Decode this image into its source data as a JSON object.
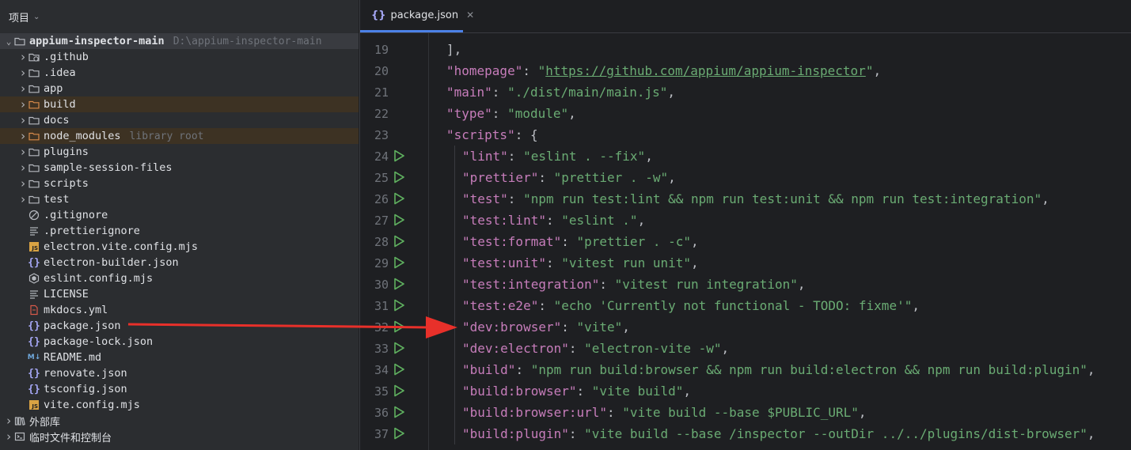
{
  "project_panel": {
    "title": "项目",
    "root": {
      "name": "appium-inspector-main",
      "path": "D:\\appium-inspector-main"
    },
    "items": [
      {
        "name": ".github",
        "icon": "folder-github-icon",
        "kind": "folder"
      },
      {
        "name": ".idea",
        "icon": "folder-icon",
        "kind": "folder"
      },
      {
        "name": "app",
        "icon": "folder-icon",
        "kind": "folder"
      },
      {
        "name": "build",
        "icon": "folder-excluded-icon",
        "kind": "folder",
        "excluded": true
      },
      {
        "name": "docs",
        "icon": "folder-icon",
        "kind": "folder"
      },
      {
        "name": "node_modules",
        "hint": "library root",
        "icon": "folder-excluded-icon",
        "kind": "folder",
        "excluded": true
      },
      {
        "name": "plugins",
        "icon": "folder-icon",
        "kind": "folder"
      },
      {
        "name": "sample-session-files",
        "icon": "folder-icon",
        "kind": "folder"
      },
      {
        "name": "scripts",
        "icon": "folder-icon",
        "kind": "folder"
      },
      {
        "name": "test",
        "icon": "folder-icon",
        "kind": "folder"
      },
      {
        "name": ".gitignore",
        "icon": "ignore-icon",
        "kind": "file"
      },
      {
        "name": ".prettierignore",
        "icon": "text-lines-icon",
        "kind": "file"
      },
      {
        "name": "electron.vite.config.mjs",
        "icon": "js-file-icon",
        "kind": "file"
      },
      {
        "name": "electron-builder.json",
        "icon": "json-file-icon",
        "kind": "file"
      },
      {
        "name": "eslint.config.mjs",
        "icon": "eslint-icon",
        "kind": "file"
      },
      {
        "name": "LICENSE",
        "icon": "text-lines-icon",
        "kind": "file"
      },
      {
        "name": "mkdocs.yml",
        "icon": "yaml-file-icon",
        "kind": "file"
      },
      {
        "name": "package.json",
        "icon": "json-file-icon",
        "kind": "file"
      },
      {
        "name": "package-lock.json",
        "icon": "json-file-icon",
        "kind": "file"
      },
      {
        "name": "README.md",
        "icon": "markdown-file-icon",
        "kind": "file"
      },
      {
        "name": "renovate.json",
        "icon": "json-file-icon",
        "kind": "file"
      },
      {
        "name": "tsconfig.json",
        "icon": "json-file-icon",
        "kind": "file"
      },
      {
        "name": "vite.config.mjs",
        "icon": "js-file-icon",
        "kind": "file"
      }
    ],
    "bottom_items": [
      {
        "name": "外部库",
        "icon": "library-icon"
      },
      {
        "name": "临时文件和控制台",
        "icon": "console-icon"
      }
    ],
    "badge_js": "JS",
    "badge_md": "M↓"
  },
  "editor": {
    "tab": {
      "label": "package.json",
      "icon": "json-file-icon"
    },
    "lines": [
      {
        "n": "19",
        "run": false,
        "indent": 1,
        "tokens": [
          [
            "p",
            "],"
          ]
        ]
      },
      {
        "n": "20",
        "run": false,
        "indent": 1,
        "tokens": [
          [
            "k",
            "\"homepage\""
          ],
          [
            "p",
            ": "
          ],
          [
            "s",
            "\""
          ],
          [
            "u",
            "https://github.com/appium/appium-inspector"
          ],
          [
            "s",
            "\""
          ],
          [
            "p",
            ","
          ]
        ]
      },
      {
        "n": "21",
        "run": false,
        "indent": 1,
        "tokens": [
          [
            "k",
            "\"main\""
          ],
          [
            "p",
            ": "
          ],
          [
            "s",
            "\"./dist/main/main.js\""
          ],
          [
            "p",
            ","
          ]
        ]
      },
      {
        "n": "22",
        "run": false,
        "indent": 1,
        "tokens": [
          [
            "k",
            "\"type\""
          ],
          [
            "p",
            ": "
          ],
          [
            "s",
            "\"module\""
          ],
          [
            "p",
            ","
          ]
        ]
      },
      {
        "n": "23",
        "run": false,
        "indent": 1,
        "tokens": [
          [
            "k",
            "\"scripts\""
          ],
          [
            "p",
            ": {"
          ]
        ]
      },
      {
        "n": "24",
        "run": true,
        "indent": 2,
        "tokens": [
          [
            "k",
            "\"lint\""
          ],
          [
            "p",
            ": "
          ],
          [
            "s",
            "\"eslint . --fix\""
          ],
          [
            "p",
            ","
          ]
        ]
      },
      {
        "n": "25",
        "run": true,
        "indent": 2,
        "tokens": [
          [
            "k",
            "\"prettier\""
          ],
          [
            "p",
            ": "
          ],
          [
            "s",
            "\"prettier . -w\""
          ],
          [
            "p",
            ","
          ]
        ]
      },
      {
        "n": "26",
        "run": true,
        "indent": 2,
        "tokens": [
          [
            "k",
            "\"test\""
          ],
          [
            "p",
            ": "
          ],
          [
            "s",
            "\"npm run test:lint && npm run test:unit && npm run test:integration\""
          ],
          [
            "p",
            ","
          ]
        ]
      },
      {
        "n": "27",
        "run": true,
        "indent": 2,
        "tokens": [
          [
            "k",
            "\"test:lint\""
          ],
          [
            "p",
            ": "
          ],
          [
            "s",
            "\"eslint .\""
          ],
          [
            "p",
            ","
          ]
        ]
      },
      {
        "n": "28",
        "run": true,
        "indent": 2,
        "tokens": [
          [
            "k",
            "\"test:format\""
          ],
          [
            "p",
            ": "
          ],
          [
            "s",
            "\"prettier . -c\""
          ],
          [
            "p",
            ","
          ]
        ]
      },
      {
        "n": "29",
        "run": true,
        "indent": 2,
        "tokens": [
          [
            "k",
            "\"test:unit\""
          ],
          [
            "p",
            ": "
          ],
          [
            "s",
            "\"vitest run unit\""
          ],
          [
            "p",
            ","
          ]
        ]
      },
      {
        "n": "30",
        "run": true,
        "indent": 2,
        "tokens": [
          [
            "k",
            "\"test:integration\""
          ],
          [
            "p",
            ": "
          ],
          [
            "s",
            "\"vitest run integration\""
          ],
          [
            "p",
            ","
          ]
        ]
      },
      {
        "n": "31",
        "run": true,
        "indent": 2,
        "tokens": [
          [
            "k",
            "\"test:e2e\""
          ],
          [
            "p",
            ": "
          ],
          [
            "s",
            "\"echo 'Currently not functional - TODO: fixme'\""
          ],
          [
            "p",
            ","
          ]
        ]
      },
      {
        "n": "32",
        "run": true,
        "indent": 2,
        "tokens": [
          [
            "k",
            "\"dev:browser\""
          ],
          [
            "p",
            ": "
          ],
          [
            "s",
            "\"vite\""
          ],
          [
            "p",
            ","
          ]
        ]
      },
      {
        "n": "33",
        "run": true,
        "indent": 2,
        "tokens": [
          [
            "k",
            "\"dev:electron\""
          ],
          [
            "p",
            ": "
          ],
          [
            "s",
            "\"electron-vite -w\""
          ],
          [
            "p",
            ","
          ]
        ]
      },
      {
        "n": "34",
        "run": true,
        "indent": 2,
        "tokens": [
          [
            "k",
            "\"build\""
          ],
          [
            "p",
            ": "
          ],
          [
            "s",
            "\"npm run build:browser && npm run build:electron && npm run build:plugin\""
          ],
          [
            "p",
            ","
          ]
        ]
      },
      {
        "n": "35",
        "run": true,
        "indent": 2,
        "tokens": [
          [
            "k",
            "\"build:browser\""
          ],
          [
            "p",
            ": "
          ],
          [
            "s",
            "\"vite build\""
          ],
          [
            "p",
            ","
          ]
        ]
      },
      {
        "n": "36",
        "run": true,
        "indent": 2,
        "tokens": [
          [
            "k",
            "\"build:browser:url\""
          ],
          [
            "p",
            ": "
          ],
          [
            "s",
            "\"vite build --base $PUBLIC_URL\""
          ],
          [
            "p",
            ","
          ]
        ]
      },
      {
        "n": "37",
        "run": true,
        "indent": 2,
        "tokens": [
          [
            "k",
            "\"build:plugin\""
          ],
          [
            "p",
            ": "
          ],
          [
            "s",
            "\"vite build --base /inspector --outDir ../../plugins/dist-browser\""
          ],
          [
            "p",
            ","
          ]
        ]
      }
    ]
  },
  "colors": {
    "key": "#c77dbb",
    "string": "#6aab73",
    "accent": "#4c81e8",
    "run_icon": "#5fb05f",
    "annotation_arrow": "#e8302a"
  }
}
